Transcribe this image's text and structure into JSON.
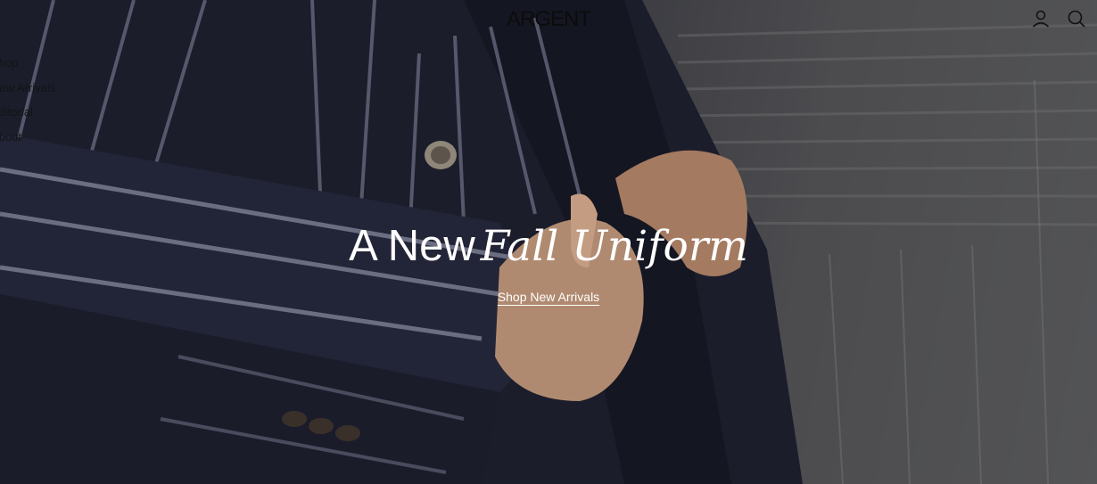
{
  "header": {
    "logo": "ARGENT",
    "icons": [
      "account-icon",
      "search-icon"
    ]
  },
  "nav": {
    "items": [
      {
        "label": "Shop"
      },
      {
        "label": "New Arrivals"
      },
      {
        "label": "Editorial"
      },
      {
        "label": "About"
      }
    ]
  },
  "hero": {
    "headline_plain": "A New",
    "headline_italic": "Fall Uniform",
    "cta_label": "Shop New Arrivals"
  },
  "colors": {
    "text_dark": "#141414",
    "text_light": "#ffffff",
    "suit_navy": "#1c1e2c"
  }
}
